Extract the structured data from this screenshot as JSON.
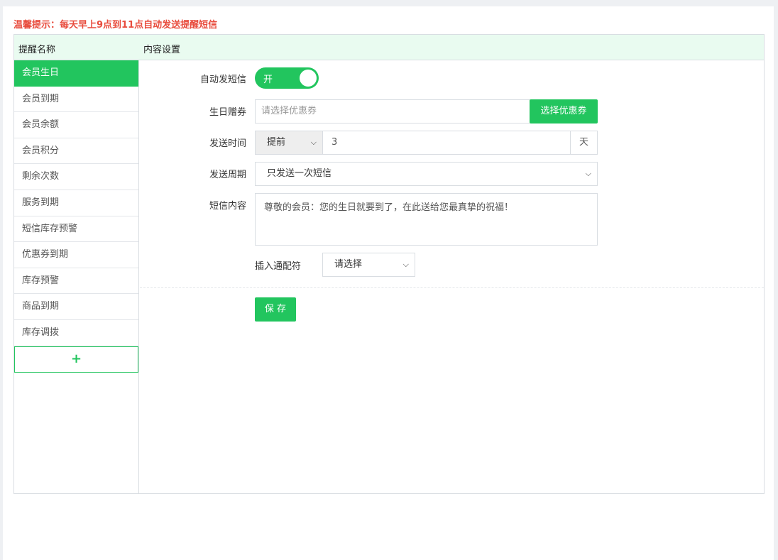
{
  "tip": "温馨提示：每天早上9点到11点自动发送提醒短信",
  "header": {
    "col1": "提醒名称",
    "col2": "内容设置"
  },
  "sidebar": {
    "items": [
      {
        "label": "会员生日"
      },
      {
        "label": "会员到期"
      },
      {
        "label": "会员余额"
      },
      {
        "label": "会员积分"
      },
      {
        "label": "剩余次数"
      },
      {
        "label": "服务到期"
      },
      {
        "label": "短信库存预警"
      },
      {
        "label": "优惠券到期"
      },
      {
        "label": "库存预警"
      },
      {
        "label": "商品到期"
      },
      {
        "label": "库存调拨"
      }
    ],
    "add_label": "+"
  },
  "form": {
    "auto_sms_label": "自动发短信",
    "toggle_text": "开",
    "coupon_label": "生日赠券",
    "coupon_placeholder": "请选择优惠券",
    "coupon_button": "选择优惠券",
    "send_time_label": "发送时间",
    "send_time_mode": "提前",
    "send_time_value": "3",
    "send_time_unit": "天",
    "period_label": "发送周期",
    "period_value": "只发送一次短信",
    "content_label": "短信内容",
    "content_value": "尊敬的会员：您的生日就要到了，在此送给您最真挚的祝福！",
    "wildcard_label": "插入通配符",
    "wildcard_value": "请选择",
    "save_button": "保 存"
  },
  "colors": {
    "accent": "#22c55e",
    "tip": "#e84c3d",
    "header_bg": "#e9fbf0"
  }
}
